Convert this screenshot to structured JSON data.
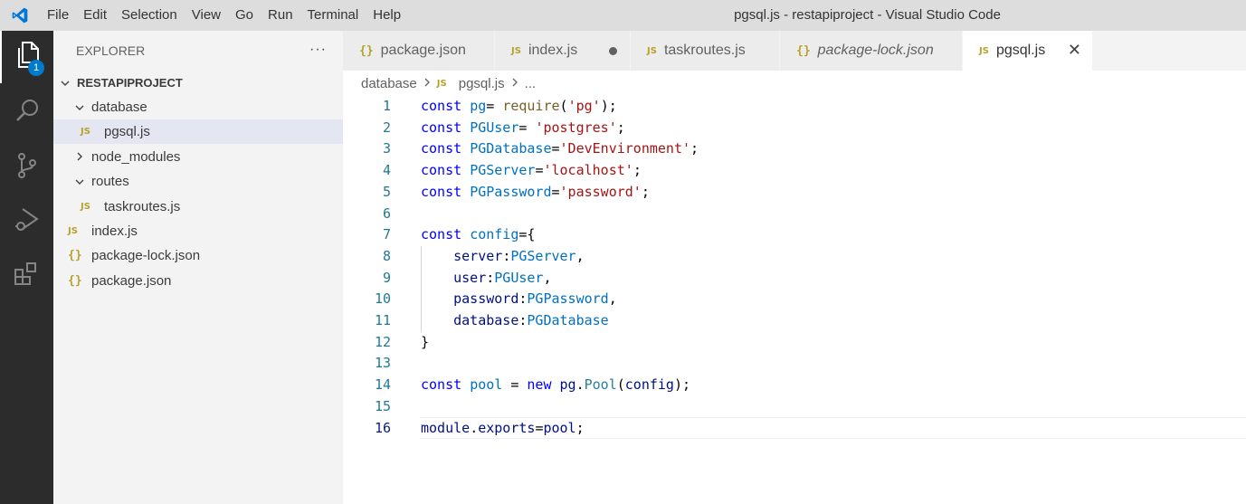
{
  "window": {
    "title": "pgsql.js - restapiproject - Visual Studio Code"
  },
  "menu": [
    "File",
    "Edit",
    "Selection",
    "View",
    "Go",
    "Run",
    "Terminal",
    "Help"
  ],
  "activity_bar": {
    "explorer_badge": "1"
  },
  "explorer": {
    "header": "EXPLORER",
    "more": "···",
    "root": "RESTAPIPROJECT",
    "items": [
      {
        "label": "database",
        "type": "folder",
        "expanded": true,
        "depth": 1
      },
      {
        "label": "pgsql.js",
        "type": "js",
        "depth": 2,
        "selected": true
      },
      {
        "label": "node_modules",
        "type": "folder",
        "expanded": false,
        "depth": 1
      },
      {
        "label": "routes",
        "type": "folder",
        "expanded": true,
        "depth": 1
      },
      {
        "label": "taskroutes.js",
        "type": "js",
        "depth": 2
      },
      {
        "label": "index.js",
        "type": "js",
        "depth": 1
      },
      {
        "label": "package-lock.json",
        "type": "json",
        "depth": 1
      },
      {
        "label": "package.json",
        "type": "json",
        "depth": 1
      }
    ]
  },
  "tabs": [
    {
      "label": "package.json",
      "icon": "json",
      "state": "normal"
    },
    {
      "label": "index.js",
      "icon": "js",
      "state": "modified"
    },
    {
      "label": "taskroutes.js",
      "icon": "js",
      "state": "normal"
    },
    {
      "label": "package-lock.json",
      "icon": "json",
      "state": "preview"
    },
    {
      "label": "pgsql.js",
      "icon": "js",
      "state": "active"
    }
  ],
  "icon_labels": {
    "js": "JS",
    "json": "{}"
  },
  "breadcrumb": {
    "folder": "database",
    "file": "pgsql.js",
    "symbol": "..."
  },
  "editor": {
    "current_line": 16,
    "lines": [
      [
        [
          "kw",
          "const"
        ],
        [
          "plain",
          " "
        ],
        [
          "var",
          "pg"
        ],
        [
          "plain",
          "= "
        ],
        [
          "fn",
          "require"
        ],
        [
          "plain",
          "("
        ],
        [
          "str",
          "'pg'"
        ],
        [
          "plain",
          ");"
        ]
      ],
      [
        [
          "kw",
          "const"
        ],
        [
          "plain",
          " "
        ],
        [
          "var",
          "PGUser"
        ],
        [
          "plain",
          "= "
        ],
        [
          "str",
          "'postgres'"
        ],
        [
          "plain",
          ";"
        ]
      ],
      [
        [
          "kw",
          "const"
        ],
        [
          "plain",
          " "
        ],
        [
          "var",
          "PGDatabase"
        ],
        [
          "plain",
          "="
        ],
        [
          "str",
          "'DevEnvironment'"
        ],
        [
          "plain",
          ";"
        ]
      ],
      [
        [
          "kw",
          "const"
        ],
        [
          "plain",
          " "
        ],
        [
          "var",
          "PGServer"
        ],
        [
          "plain",
          "="
        ],
        [
          "str",
          "'localhost'"
        ],
        [
          "plain",
          ";"
        ]
      ],
      [
        [
          "kw",
          "const"
        ],
        [
          "plain",
          " "
        ],
        [
          "var",
          "PGPassword"
        ],
        [
          "plain",
          "="
        ],
        [
          "str",
          "'password'"
        ],
        [
          "plain",
          ";"
        ]
      ],
      [],
      [
        [
          "kw",
          "const"
        ],
        [
          "plain",
          " "
        ],
        [
          "var",
          "config"
        ],
        [
          "plain",
          "={"
        ]
      ],
      [
        [
          "plain",
          "    "
        ],
        [
          "prop",
          "server"
        ],
        [
          "plain",
          ":"
        ],
        [
          "var",
          "PGServer"
        ],
        [
          "plain",
          ","
        ]
      ],
      [
        [
          "plain",
          "    "
        ],
        [
          "prop",
          "user"
        ],
        [
          "plain",
          ":"
        ],
        [
          "var",
          "PGUser"
        ],
        [
          "plain",
          ","
        ]
      ],
      [
        [
          "plain",
          "    "
        ],
        [
          "prop",
          "password"
        ],
        [
          "plain",
          ":"
        ],
        [
          "var",
          "PGPassword"
        ],
        [
          "plain",
          ","
        ]
      ],
      [
        [
          "plain",
          "    "
        ],
        [
          "prop",
          "database"
        ],
        [
          "plain",
          ":"
        ],
        [
          "var",
          "PGDatabase"
        ]
      ],
      [
        [
          "plain",
          "}"
        ]
      ],
      [],
      [
        [
          "kw",
          "const"
        ],
        [
          "plain",
          " "
        ],
        [
          "var",
          "pool"
        ],
        [
          "plain",
          " = "
        ],
        [
          "kw",
          "new"
        ],
        [
          "plain",
          " "
        ],
        [
          "prop",
          "pg"
        ],
        [
          "plain",
          "."
        ],
        [
          "cls",
          "Pool"
        ],
        [
          "plain",
          "("
        ],
        [
          "prop",
          "config"
        ],
        [
          "plain",
          ");"
        ]
      ],
      [],
      [
        [
          "prop",
          "module"
        ],
        [
          "plain",
          "."
        ],
        [
          "prop",
          "exports"
        ],
        [
          "plain",
          "="
        ],
        [
          "prop",
          "pool"
        ],
        [
          "plain",
          ";"
        ]
      ]
    ]
  },
  "colors": {
    "accent": "#007acc",
    "activity_bar": "#2c2c2c",
    "sidebar": "#f3f3f3",
    "keyword": "#0000ff",
    "variable": "#0070c1",
    "string": "#a31515",
    "function": "#795e26",
    "property": "#001080",
    "class": "#267f99"
  }
}
